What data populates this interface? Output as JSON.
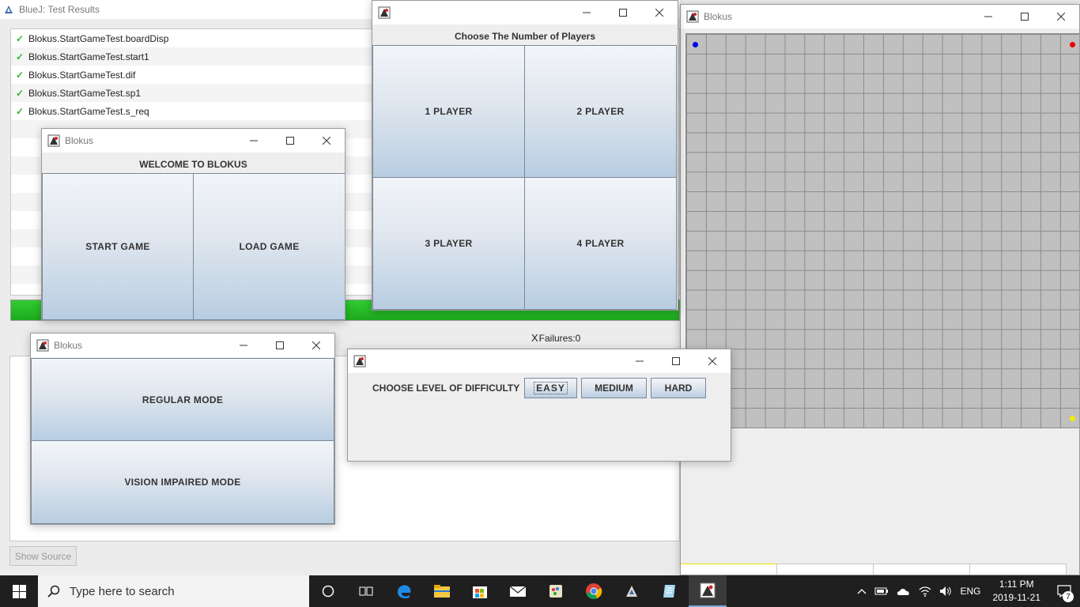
{
  "bluej": {
    "title": "BlueJ:  Test Results",
    "results": [
      "Blokus.StartGameTest.boardDisp",
      "Blokus.StartGameTest.start1",
      "Blokus.StartGameTest.dif",
      "Blokus.StartGameTest.sp1",
      "Blokus.StartGameTest.s_req"
    ],
    "progress_fraction": 1.0,
    "progress_color": "#22bb22",
    "failures": "Failures:0",
    "failures_prefix": "X",
    "show_source": "Show Source"
  },
  "board_window": {
    "title": "Blokus",
    "grid_size": 20,
    "corner_colors": {
      "top_left": "#0000ee",
      "top_right": "#ee0000",
      "bottom_right": "#eeee00"
    }
  },
  "players_window": {
    "title": "",
    "heading": "Choose The Number of Players",
    "buttons": [
      "1 PLAYER",
      "2 PLAYER",
      "3 PLAYER",
      "4 PLAYER"
    ]
  },
  "welcome_window": {
    "title": "Blokus",
    "heading": "WELCOME TO BLOKUS",
    "start_label": "START GAME",
    "load_label": "LOAD GAME"
  },
  "mode_window": {
    "title": "Blokus",
    "regular_label": "REGULAR MODE",
    "vision_label": "VISION IMPAIRED MODE"
  },
  "difficulty_window": {
    "title": "",
    "prompt": "CHOOSE LEVEL OF DIFFICULTY",
    "easy": "EASY",
    "medium": "MEDIUM",
    "hard": "HARD"
  },
  "taskbar": {
    "search_placeholder": "Type here to search",
    "apps": [
      "task-view-icon",
      "edge-icon",
      "file-explorer-icon",
      "store-icon",
      "mail-icon",
      "paint-icon",
      "chrome-icon",
      "bluej-icon",
      "notepad-icon",
      "blokus-icon"
    ],
    "language": "ENG",
    "time": "1:11 PM",
    "date": "2019-11-21",
    "notification_count": "7"
  }
}
